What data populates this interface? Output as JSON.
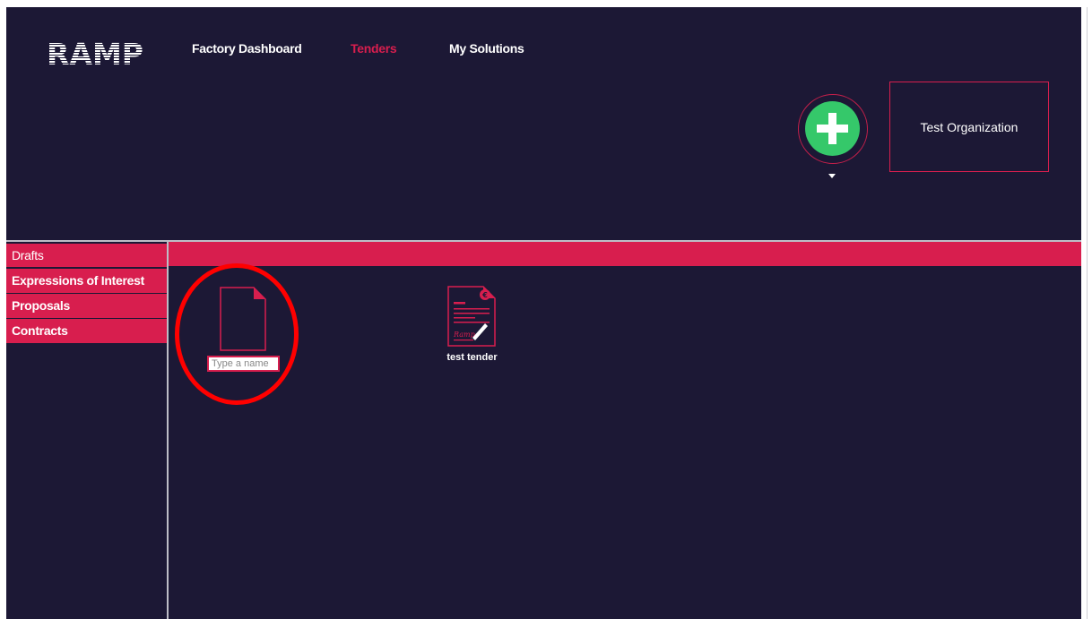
{
  "header": {
    "logo_text": "RAMP",
    "nav": {
      "factory_dashboard": "Factory Dashboard",
      "tenders": "Tenders",
      "my_solutions": "My Solutions"
    },
    "active_nav": "tenders",
    "organization": "Test Organization"
  },
  "sidebar": {
    "items": [
      {
        "label": "Drafts",
        "active": true
      },
      {
        "label": "Expressions of Interest",
        "active": false
      },
      {
        "label": "Proposals",
        "active": false
      },
      {
        "label": "Contracts",
        "active": false
      }
    ]
  },
  "main": {
    "new_item": {
      "name_placeholder": "Type a name",
      "name_value": ""
    },
    "tenders": [
      {
        "name": "test tender",
        "icon": "tender-document-icon",
        "signature_text": "Ramp",
        "currency_symbol": "€"
      }
    ]
  },
  "colors": {
    "background": "#1c1835",
    "accent": "#d81e4e",
    "add_button": "#35c86a",
    "active_nav": "#d81e4e",
    "annotation": "#ff0000"
  },
  "icons": {
    "add": "plus-icon",
    "dropdown": "caret-down-icon",
    "new_document": "document-icon"
  }
}
